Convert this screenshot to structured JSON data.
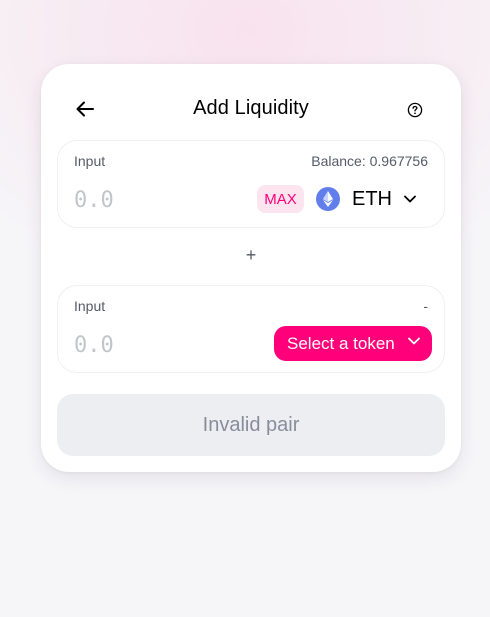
{
  "header": {
    "title": "Add Liquidity",
    "back_icon": "arrow-left-icon",
    "help_icon": "question-circle-icon"
  },
  "input_a": {
    "label": "Input",
    "balance": "Balance: 0.967756",
    "placeholder": "0.0",
    "max_label": "MAX",
    "token_symbol": "ETH",
    "token_icon": "ethereum-icon",
    "dropdown_icon": "chevron-down-icon"
  },
  "separator": "+",
  "input_b": {
    "label": "Input",
    "balance": "-",
    "placeholder": "0.0",
    "select_label": "Select a token",
    "dropdown_icon": "chevron-down-icon"
  },
  "submit": {
    "label": "Invalid pair"
  },
  "colors": {
    "accent": "#ff007a",
    "accent_light": "#fde5f0",
    "eth_blue": "#627eea",
    "disabled_bg": "#edeef2",
    "disabled_text": "#888d9b"
  }
}
